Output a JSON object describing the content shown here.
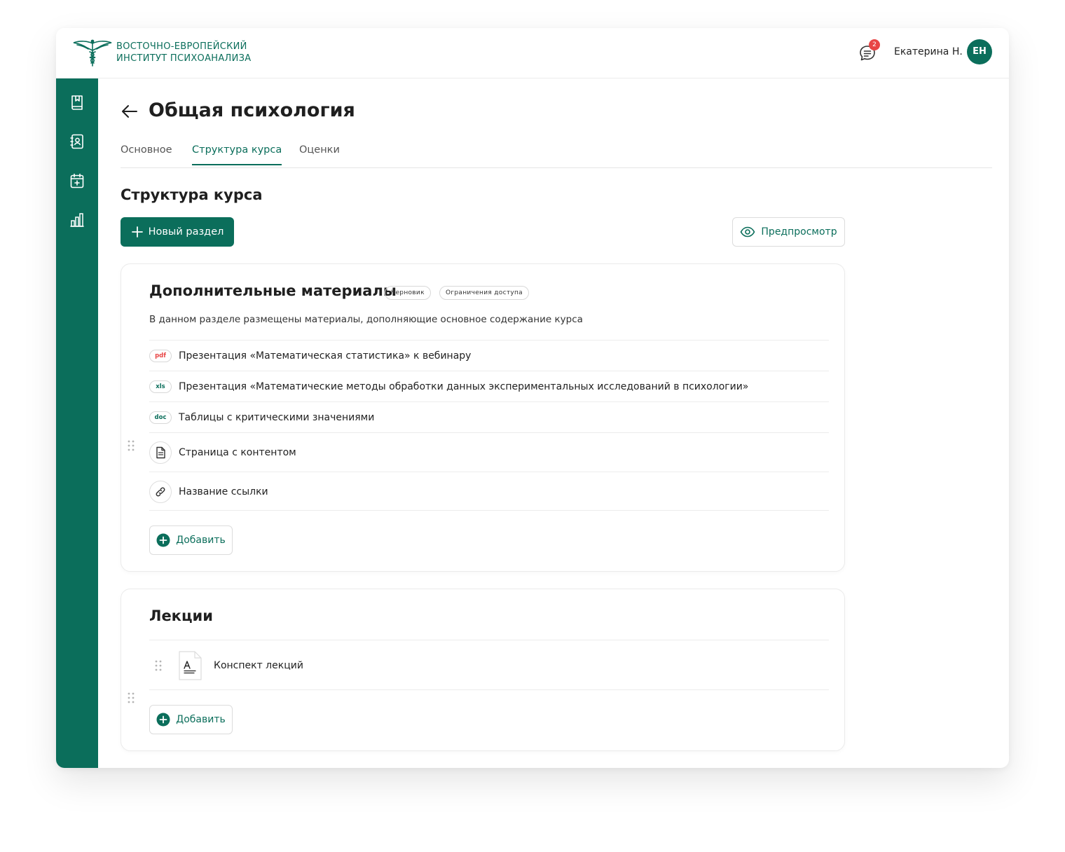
{
  "brand": {
    "line1": "Восточно-европейский",
    "line2": "институт психоанализа",
    "accent_color": "#0b6e5b"
  },
  "header": {
    "notifications_count": "2",
    "user_name": "Екатерина Н.",
    "user_initials": "ЕН"
  },
  "sidebar": {
    "items": [
      {
        "icon": "book-icon"
      },
      {
        "icon": "contacts-icon"
      },
      {
        "icon": "calendar-add-icon"
      },
      {
        "icon": "bar-chart-icon"
      }
    ]
  },
  "page": {
    "title": "Общая психология",
    "tabs": [
      {
        "label": "Основное",
        "active": false
      },
      {
        "label": "Структура курса",
        "active": true
      },
      {
        "label": "Оценки",
        "active": false
      }
    ],
    "section_heading": "Структура курса",
    "new_section_label": "Новый раздел",
    "preview_label": "Предпросмотр"
  },
  "sections": [
    {
      "title": "Дополнительные материалы",
      "tags": [
        "Черновик",
        "Ограничения доступа"
      ],
      "description": "В данном разделе размещены материалы, дополняющие основное содержание курса",
      "items": [
        {
          "type": "pdf",
          "label": "Презентация «Математическая статистика» к вебинару"
        },
        {
          "type": "xls",
          "label": "Презентация «Математические методы обработки данных экспериментальных исследований в психологии»"
        },
        {
          "type": "doc",
          "label": "Таблицы с критическими значениями"
        },
        {
          "type": "page",
          "label": "Страница с контентом"
        },
        {
          "type": "link",
          "label": "Название ссылки"
        }
      ],
      "add_label": "Добавить"
    },
    {
      "title": "Лекции",
      "items": [
        {
          "type": "text-doc",
          "label": "Конспект лекций"
        }
      ],
      "add_label": "Добавить"
    }
  ],
  "colors": {
    "pdf": "#e84545",
    "xls": "#0b6e5b",
    "doc": "#0b6e5b",
    "badge": "#e84545"
  }
}
